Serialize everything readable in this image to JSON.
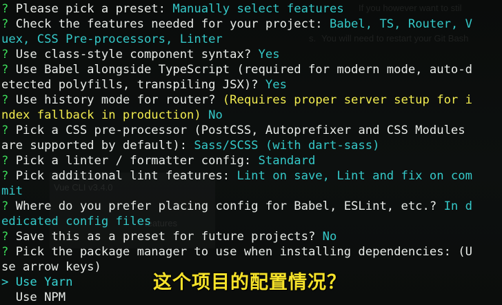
{
  "background_ghost_text": [
    "If you however want to stil",
    "s.",
    "You will need to restart your Git Bash",
    "Vue CLI v3.4.0",
    "features"
  ],
  "lines": [
    [
      {
        "t": "? ",
        "c": "q"
      },
      {
        "t": "Please pick a preset: ",
        "c": "txt"
      },
      {
        "t": "Manually select features",
        "c": "ans"
      }
    ],
    [
      {
        "t": "? ",
        "c": "q"
      },
      {
        "t": "Check the features needed for your project: ",
        "c": "txt"
      },
      {
        "t": "Babel, TS, Router, V",
        "c": "ans"
      }
    ],
    [
      {
        "t": "uex, CSS Pre-processors, Linter",
        "c": "ans"
      }
    ],
    [
      {
        "t": "? ",
        "c": "q"
      },
      {
        "t": "Use class-style component syntax? ",
        "c": "txt"
      },
      {
        "t": "Yes",
        "c": "ans"
      }
    ],
    [
      {
        "t": "? ",
        "c": "q"
      },
      {
        "t": "Use Babel alongside TypeScript (required for modern mode, auto-d",
        "c": "txt"
      }
    ],
    [
      {
        "t": "etected polyfills, transpiling JSX)? ",
        "c": "txt"
      },
      {
        "t": "Yes",
        "c": "ans"
      }
    ],
    [
      {
        "t": "? ",
        "c": "q"
      },
      {
        "t": "Use history mode for router? ",
        "c": "txt"
      },
      {
        "t": "(Requires proper server setup for i",
        "c": "warn"
      }
    ],
    [
      {
        "t": "ndex fallback in production) ",
        "c": "warn"
      },
      {
        "t": "No",
        "c": "ans"
      }
    ],
    [
      {
        "t": "? ",
        "c": "q"
      },
      {
        "t": "Pick a CSS pre-processor (PostCSS, Autoprefixer and CSS Modules",
        "c": "txt"
      }
    ],
    [
      {
        "t": "are supported by default): ",
        "c": "txt"
      },
      {
        "t": "Sass/SCSS (with dart-sass)",
        "c": "ans"
      }
    ],
    [
      {
        "t": "? ",
        "c": "q"
      },
      {
        "t": "Pick a linter / formatter config: ",
        "c": "txt"
      },
      {
        "t": "Standard",
        "c": "ans"
      }
    ],
    [
      {
        "t": "? ",
        "c": "q"
      },
      {
        "t": "Pick additional lint features: ",
        "c": "txt"
      },
      {
        "t": "Lint on save, Lint and fix on com",
        "c": "ans"
      }
    ],
    [
      {
        "t": "mit",
        "c": "ans"
      }
    ],
    [
      {
        "t": "? ",
        "c": "q"
      },
      {
        "t": "Where do you prefer placing config for Babel, ESLint, etc.? ",
        "c": "txt"
      },
      {
        "t": "In d",
        "c": "ans"
      }
    ],
    [
      {
        "t": "edicated config files",
        "c": "ans"
      }
    ],
    [
      {
        "t": "? ",
        "c": "q"
      },
      {
        "t": "Save this as a preset for future projects? ",
        "c": "txt"
      },
      {
        "t": "No",
        "c": "ans"
      }
    ],
    [
      {
        "t": "? ",
        "c": "q"
      },
      {
        "t": "Pick the package manager to use when installing dependencies: (U",
        "c": "txt"
      }
    ],
    [
      {
        "t": "se arrow keys)",
        "c": "txt"
      }
    ],
    [
      {
        "t": "> Use Yarn",
        "c": "ptr"
      }
    ],
    [
      {
        "t": "  Use NPM",
        "c": "txt"
      }
    ]
  ],
  "caption": "这个项目的配置情况？",
  "colors": {
    "background": "#0b0d0c",
    "question_mark": "#3ddc5a",
    "answer": "#35c9c9",
    "warning": "#f2ec50",
    "text": "#e9ece9",
    "caption": "#f6e22a"
  }
}
